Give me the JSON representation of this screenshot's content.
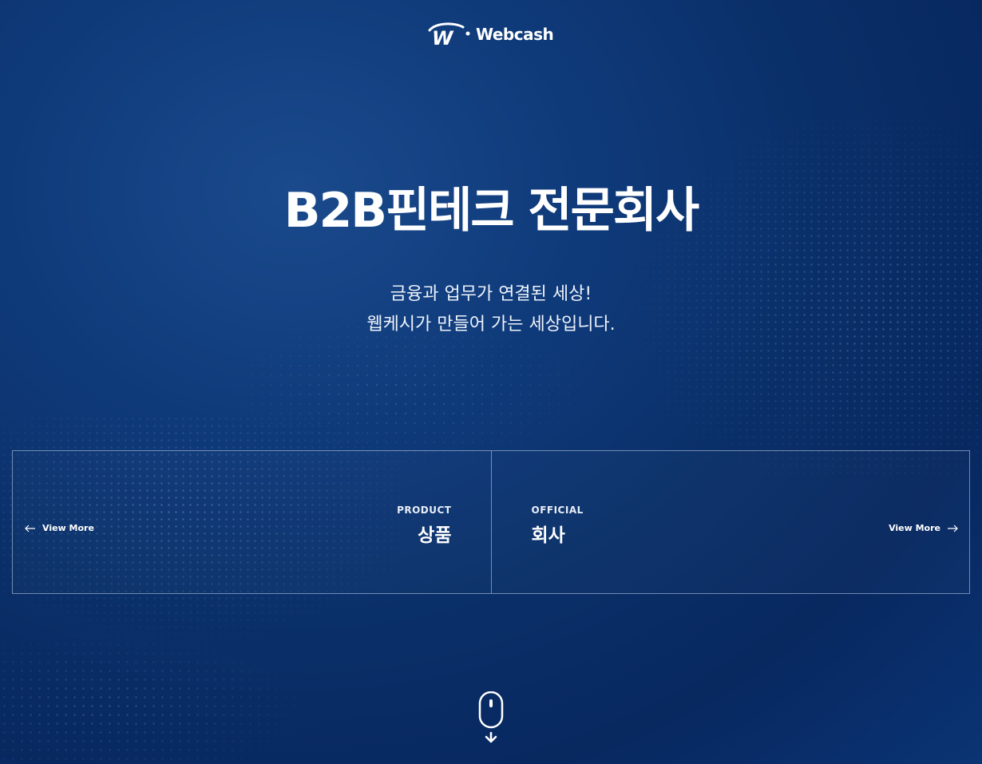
{
  "header": {
    "logo_text": "Webcash",
    "logo_mark": "W"
  },
  "hero": {
    "title": "B2B핀테크 전문회사",
    "subtitle_line1": "금융과 업무가 연결된 세상!",
    "subtitle_line2": "웹케시가 만들어 가는 세상입니다."
  },
  "cards": [
    {
      "eyebrow": "PRODUCT",
      "title": "상품",
      "link_label": "View More",
      "arrow": "arrow-left-icon"
    },
    {
      "eyebrow": "OFFICIAL",
      "title": "회사",
      "link_label": "View More",
      "arrow": "arrow-right-icon"
    }
  ],
  "scroll_indicator": {
    "icon": "mouse-scroll-icon"
  },
  "colors": {
    "background_dark": "#082860",
    "background_mid": "#0f3a7a",
    "text": "#ffffff",
    "border": "#c8d7f0"
  }
}
